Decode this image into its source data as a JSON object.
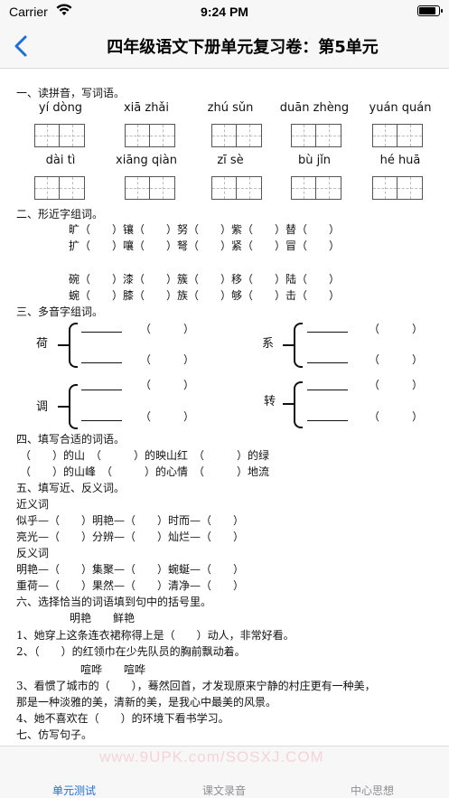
{
  "status_bar": {
    "carrier": "Carrier",
    "time": "9:24 PM",
    "battery_level": 0.9
  },
  "nav": {
    "title": "四年级语文下册单元复习卷：第5单元"
  },
  "colors": {
    "accent": "#1e6fd9",
    "inactive": "#8e8e93",
    "bar_bg": "#f7f7f7"
  },
  "sections": {
    "s1": {
      "heading": "一、读拼音，写词语。",
      "row1": [
        "yí dòng",
        "xiā zhǎi",
        "zhú sǔn",
        "duān zhèng",
        "yuán quán"
      ],
      "row2": [
        "dài tì",
        "xiāng qiàn",
        "zī sè",
        "bù jǐn",
        "hé huā"
      ]
    },
    "s2": {
      "heading": "二、形近字组词。",
      "lines": [
        "旷（　　）镶（　　）努（　　）紫（　　）替（　　）",
        "扩（　　）嚷（　　）弩（　　）紧（　　）冒（　　）",
        "碗（　　）漆（　　）簇（　　）移（　　）陆（　　）",
        "蜿（　　）膝（　　）族（　　）够（　　）击（　　）"
      ]
    },
    "s3": {
      "heading": "三、多音字组词。",
      "chars": [
        "荷",
        "系",
        "调",
        "转"
      ],
      "paren": "（　　　）"
    },
    "s4": {
      "heading": "四、填写合适的词语。",
      "line1": "（　　）的山　（　　　）的映山红　（　　　）的绿",
      "line2": "（　　）的山峰　（　　　）的心情　（　　　）地流"
    },
    "s5": {
      "heading": "五、填写近、反义词。",
      "syn_label": "近义词",
      "syn1": "似乎—（　　）明艳—（　　）时而—（　　）",
      "syn2": "亮光—（　　）分辨—（　　）灿烂—（　　）",
      "ant_label": "反义词",
      "ant1": "明艳—（　　）集聚—（　　）蜿蜒—（　　）",
      "ant2": "重荷—（　　）果然—（　　）清净—（　　）"
    },
    "s6": {
      "heading": "六、选择恰当的词语填到句中的括号里。",
      "opts1": "明艳　　鲜艳",
      "q1": "1、她穿上这条连衣裙称得上是（　　）动人，非常好看。",
      "q2": "2、（　　）的红领巾在少先队员的胸前飘动着。",
      "opts2": "喧哗　　喧哗",
      "q3a": "3、看惯了城市的（　　），蓦然回首，才发现原来宁静的村庄更有一种美，",
      "q3b": "那是一种淡雅的美，清新的美，是我心中最美的风景。",
      "q4": "4、她不喜欢在（　　）的环境下看书学习。"
    },
    "s7": {
      "heading": "七、仿写句子。"
    }
  },
  "tabs": [
    {
      "label": "单元测试",
      "active": true
    },
    {
      "label": "课文录音",
      "active": false
    },
    {
      "label": "中心思想",
      "active": false
    }
  ],
  "watermark": "www.9UPK.com/SOSXJ.COM"
}
